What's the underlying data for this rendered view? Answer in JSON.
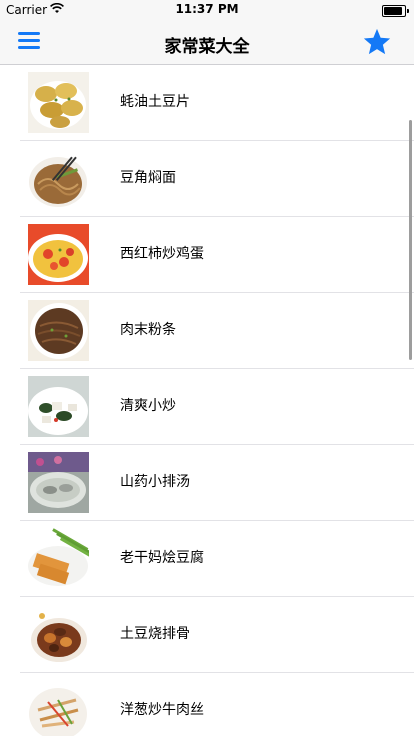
{
  "status_bar": {
    "carrier": "Carrier",
    "time": "11:37 PM",
    "wifi_icon": "wifi-icon",
    "battery_icon": "battery-full-icon"
  },
  "nav": {
    "title": "家常菜大全",
    "menu_icon": "menu-icon",
    "favorite_icon": "star-icon",
    "accent": "#1479f6"
  },
  "dishes": [
    {
      "name": "蚝油土豆片"
    },
    {
      "name": "豆角焖面"
    },
    {
      "name": "西红柿炒鸡蛋"
    },
    {
      "name": "肉末粉条"
    },
    {
      "name": "清爽小炒"
    },
    {
      "name": "山药小排汤"
    },
    {
      "name": "老干妈烩豆腐"
    },
    {
      "name": "土豆烧排骨"
    },
    {
      "name": "洋葱炒牛肉丝"
    }
  ]
}
